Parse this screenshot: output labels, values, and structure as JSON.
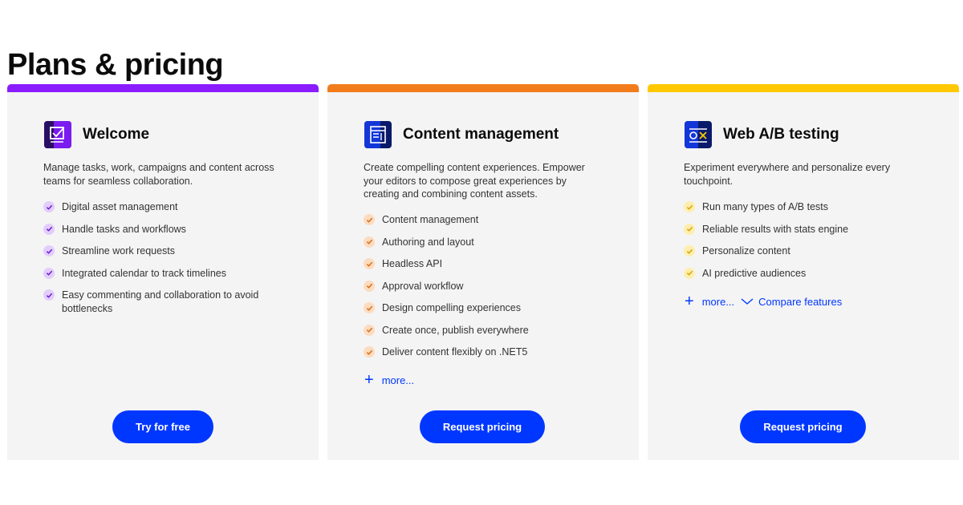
{
  "page": {
    "title": "Plans & pricing"
  },
  "colors": {
    "accent": "#0037ff",
    "welcome": "#8a1cff",
    "content": "#f27c1b",
    "ab": "#ffc800"
  },
  "cards": [
    {
      "title": "Welcome",
      "icon": "checkbox-board-icon",
      "description": "Manage tasks, work, campaigns and content across teams for seamless collaboration.",
      "features": [
        "Digital asset management",
        "Handle tasks and workflows",
        "Streamline work requests",
        "Integrated calendar to track timelines",
        "Easy commenting and collaboration to avoid bottlenecks"
      ],
      "cta": "Try for free"
    },
    {
      "title": "Content management",
      "icon": "document-layout-icon",
      "description": "Create compelling content experiences. Empower your editors to compose great experiences by creating and combining content assets.",
      "features": [
        "Content management",
        "Authoring and layout",
        "Headless API",
        "Approval workflow",
        "Design compelling experiences",
        "Create once, publish everywhere",
        "Deliver content flexibly on .NET5"
      ],
      "more": "more...",
      "cta": "Request pricing"
    },
    {
      "title": "Web A/B testing",
      "icon": "ab-test-icon",
      "description": "Experiment everywhere and personalize every touchpoint.",
      "features": [
        "Run many types of A/B tests",
        "Reliable results with stats engine",
        "Personalize content",
        "AI predictive audiences"
      ],
      "more": "more...",
      "compare": "Compare features",
      "cta": "Request pricing"
    }
  ]
}
